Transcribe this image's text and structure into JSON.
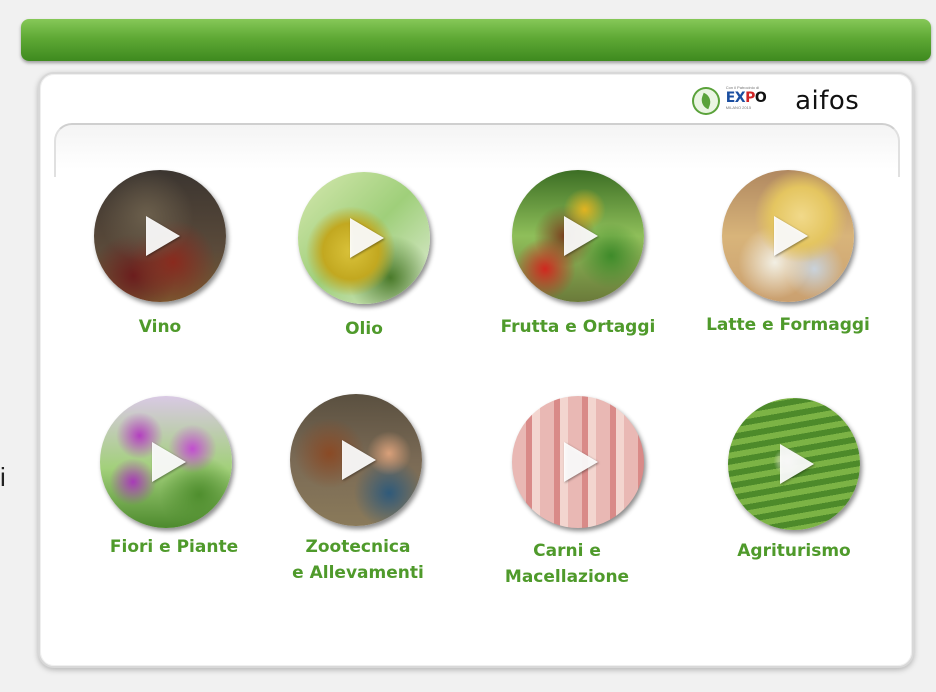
{
  "stray_text": "i",
  "logos": {
    "expo_small_text": "Con il Patrocinio di",
    "expo_wordmark": "EXPO",
    "expo_subtext": "MILANO 2015",
    "brand": "aifos"
  },
  "tiles": [
    {
      "label": "Vino",
      "image": "wine-image"
    },
    {
      "label": "Olio",
      "image": "olive-oil-image"
    },
    {
      "label": "Frutta e Ortaggi",
      "image": "fruit-vegetables-image"
    },
    {
      "label": "Latte e Formaggi",
      "image": "cheese-image"
    },
    {
      "label": "Fiori e Piante",
      "image": "flowers-image"
    },
    {
      "label": "Zootecnica\ne Allevamenti",
      "image": "livestock-image"
    },
    {
      "label": "Carni e Macellazione",
      "image": "meat-image"
    },
    {
      "label": "Agriturismo",
      "image": "farmhouse-image"
    }
  ],
  "colors": {
    "header_green": "#5fa935",
    "label_green": "#4f9a2b"
  }
}
